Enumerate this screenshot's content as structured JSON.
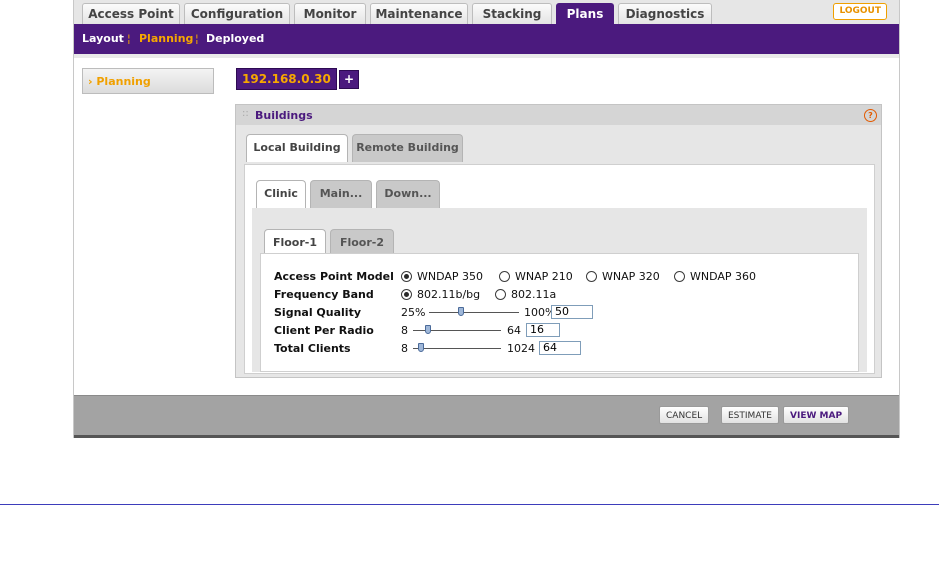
{
  "top_tabs": [
    "Access Point",
    "Configuration",
    "Monitor",
    "Maintenance",
    "Stacking",
    "Plans",
    "Diagnostics"
  ],
  "active_top_tab": "Plans",
  "logout_label": "LOGOUT",
  "subnav": {
    "layout": "Layout",
    "planning": "Planning",
    "deployed": "Deployed",
    "separator": "¦"
  },
  "left_menu": {
    "item": "› Planning"
  },
  "ip": {
    "address": "192.168.0.30",
    "add": "+"
  },
  "buildings": {
    "title": "Buildings",
    "help": "?",
    "building_tabs": [
      "Local Building",
      "Remote Building"
    ],
    "site_tabs": [
      "Clinic",
      "Main...",
      "Down..."
    ],
    "floor_tabs": [
      "Floor-1",
      "Floor-2"
    ]
  },
  "form": {
    "ap_model_label": "Access Point Model",
    "ap_models": [
      "WNDAP 350",
      "WNAP 210",
      "WNAP 320",
      "WNDAP 360"
    ],
    "ap_model_selected": "WNDAP 350",
    "band_label": "Frequency Band",
    "bands": [
      "802.11b/bg",
      "802.11a"
    ],
    "band_selected": "802.11b/bg",
    "signal_label": "Signal Quality",
    "signal_min": "25%",
    "signal_max": "100%",
    "signal_value": "50",
    "client_label": "Client Per Radio",
    "client_min": "8",
    "client_max": "64",
    "client_value": "16",
    "total_label": "Total Clients",
    "total_min": "8",
    "total_max": "1024",
    "total_value": "64"
  },
  "buttons": {
    "cancel": "CANCEL",
    "estimate": "ESTIMATE",
    "view_map": "VIEW MAP"
  },
  "colors": {
    "brand_purple": "#4b1a7e",
    "accent_orange": "#f7a800"
  }
}
